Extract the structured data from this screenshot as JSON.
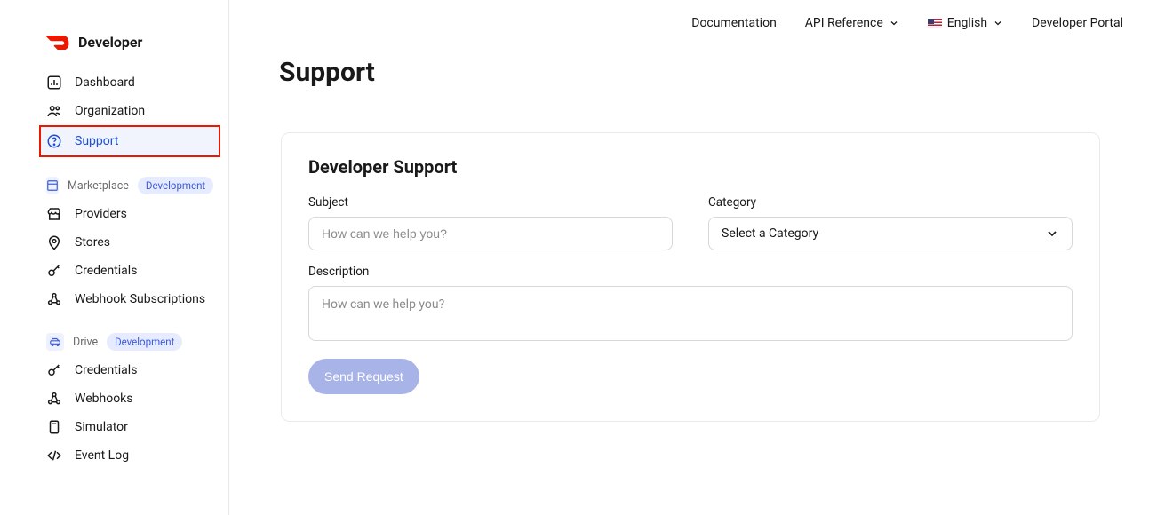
{
  "brand": {
    "text": "Developer"
  },
  "sidebar": {
    "main": [
      {
        "label": "Dashboard"
      },
      {
        "label": "Organization"
      },
      {
        "label": "Support"
      }
    ],
    "marketplace": {
      "title": "Marketplace",
      "pill": "Development",
      "items": [
        {
          "label": "Providers"
        },
        {
          "label": "Stores"
        },
        {
          "label": "Credentials"
        },
        {
          "label": "Webhook Subscriptions"
        }
      ]
    },
    "drive": {
      "title": "Drive",
      "pill": "Development",
      "items": [
        {
          "label": "Credentials"
        },
        {
          "label": "Webhooks"
        },
        {
          "label": "Simulator"
        },
        {
          "label": "Event Log"
        }
      ]
    }
  },
  "topnav": {
    "documentation": "Documentation",
    "api_reference": "API Reference",
    "language": "English",
    "portal": "Developer Portal"
  },
  "page": {
    "title": "Support"
  },
  "form": {
    "title": "Developer Support",
    "subject_label": "Subject",
    "subject_placeholder": "How can we help you?",
    "category_label": "Category",
    "category_placeholder": "Select a Category",
    "description_label": "Description",
    "description_placeholder": "How can we help you?",
    "submit": "Send Request"
  }
}
